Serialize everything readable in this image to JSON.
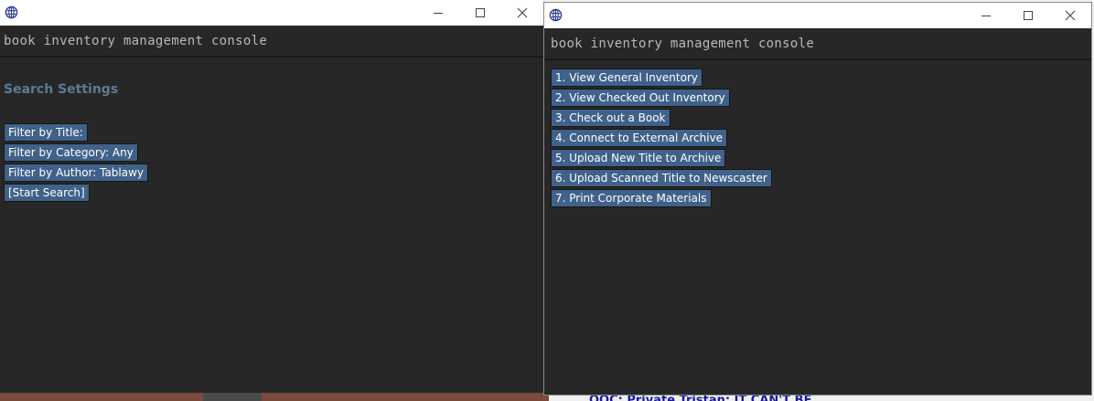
{
  "background": {
    "chat_line": "OOC: Private Tristan: IT CAN'T BE"
  },
  "left_window": {
    "header": "book inventory management console",
    "section_title": "Search Settings",
    "links": [
      {
        "label": "Filter by Title:"
      },
      {
        "label": "Filter by Category: Any"
      },
      {
        "label": "Filter by Author: Tablawy"
      },
      {
        "label": "[Start Search]"
      }
    ]
  },
  "right_window": {
    "header": "book inventory management console",
    "menu": [
      {
        "label": "1. View General Inventory"
      },
      {
        "label": "2. View Checked Out Inventory"
      },
      {
        "label": "3. Check out a Book"
      },
      {
        "label": "4. Connect to External Archive"
      },
      {
        "label": "5. Upload New Title to Archive"
      },
      {
        "label": "6. Upload Scanned Title to Newscaster"
      },
      {
        "label": "7. Print Corporate Materials"
      }
    ]
  },
  "titlebar": {
    "minimize_icon": "minimize-icon",
    "maximize_icon": "maximize-icon",
    "close_icon": "close-icon",
    "app_icon": "globe-icon"
  },
  "colors": {
    "window_bg": "#272727",
    "link_bg": "#40628a",
    "section_title": "#5d7a94",
    "header_text": "#b8b8b8"
  }
}
